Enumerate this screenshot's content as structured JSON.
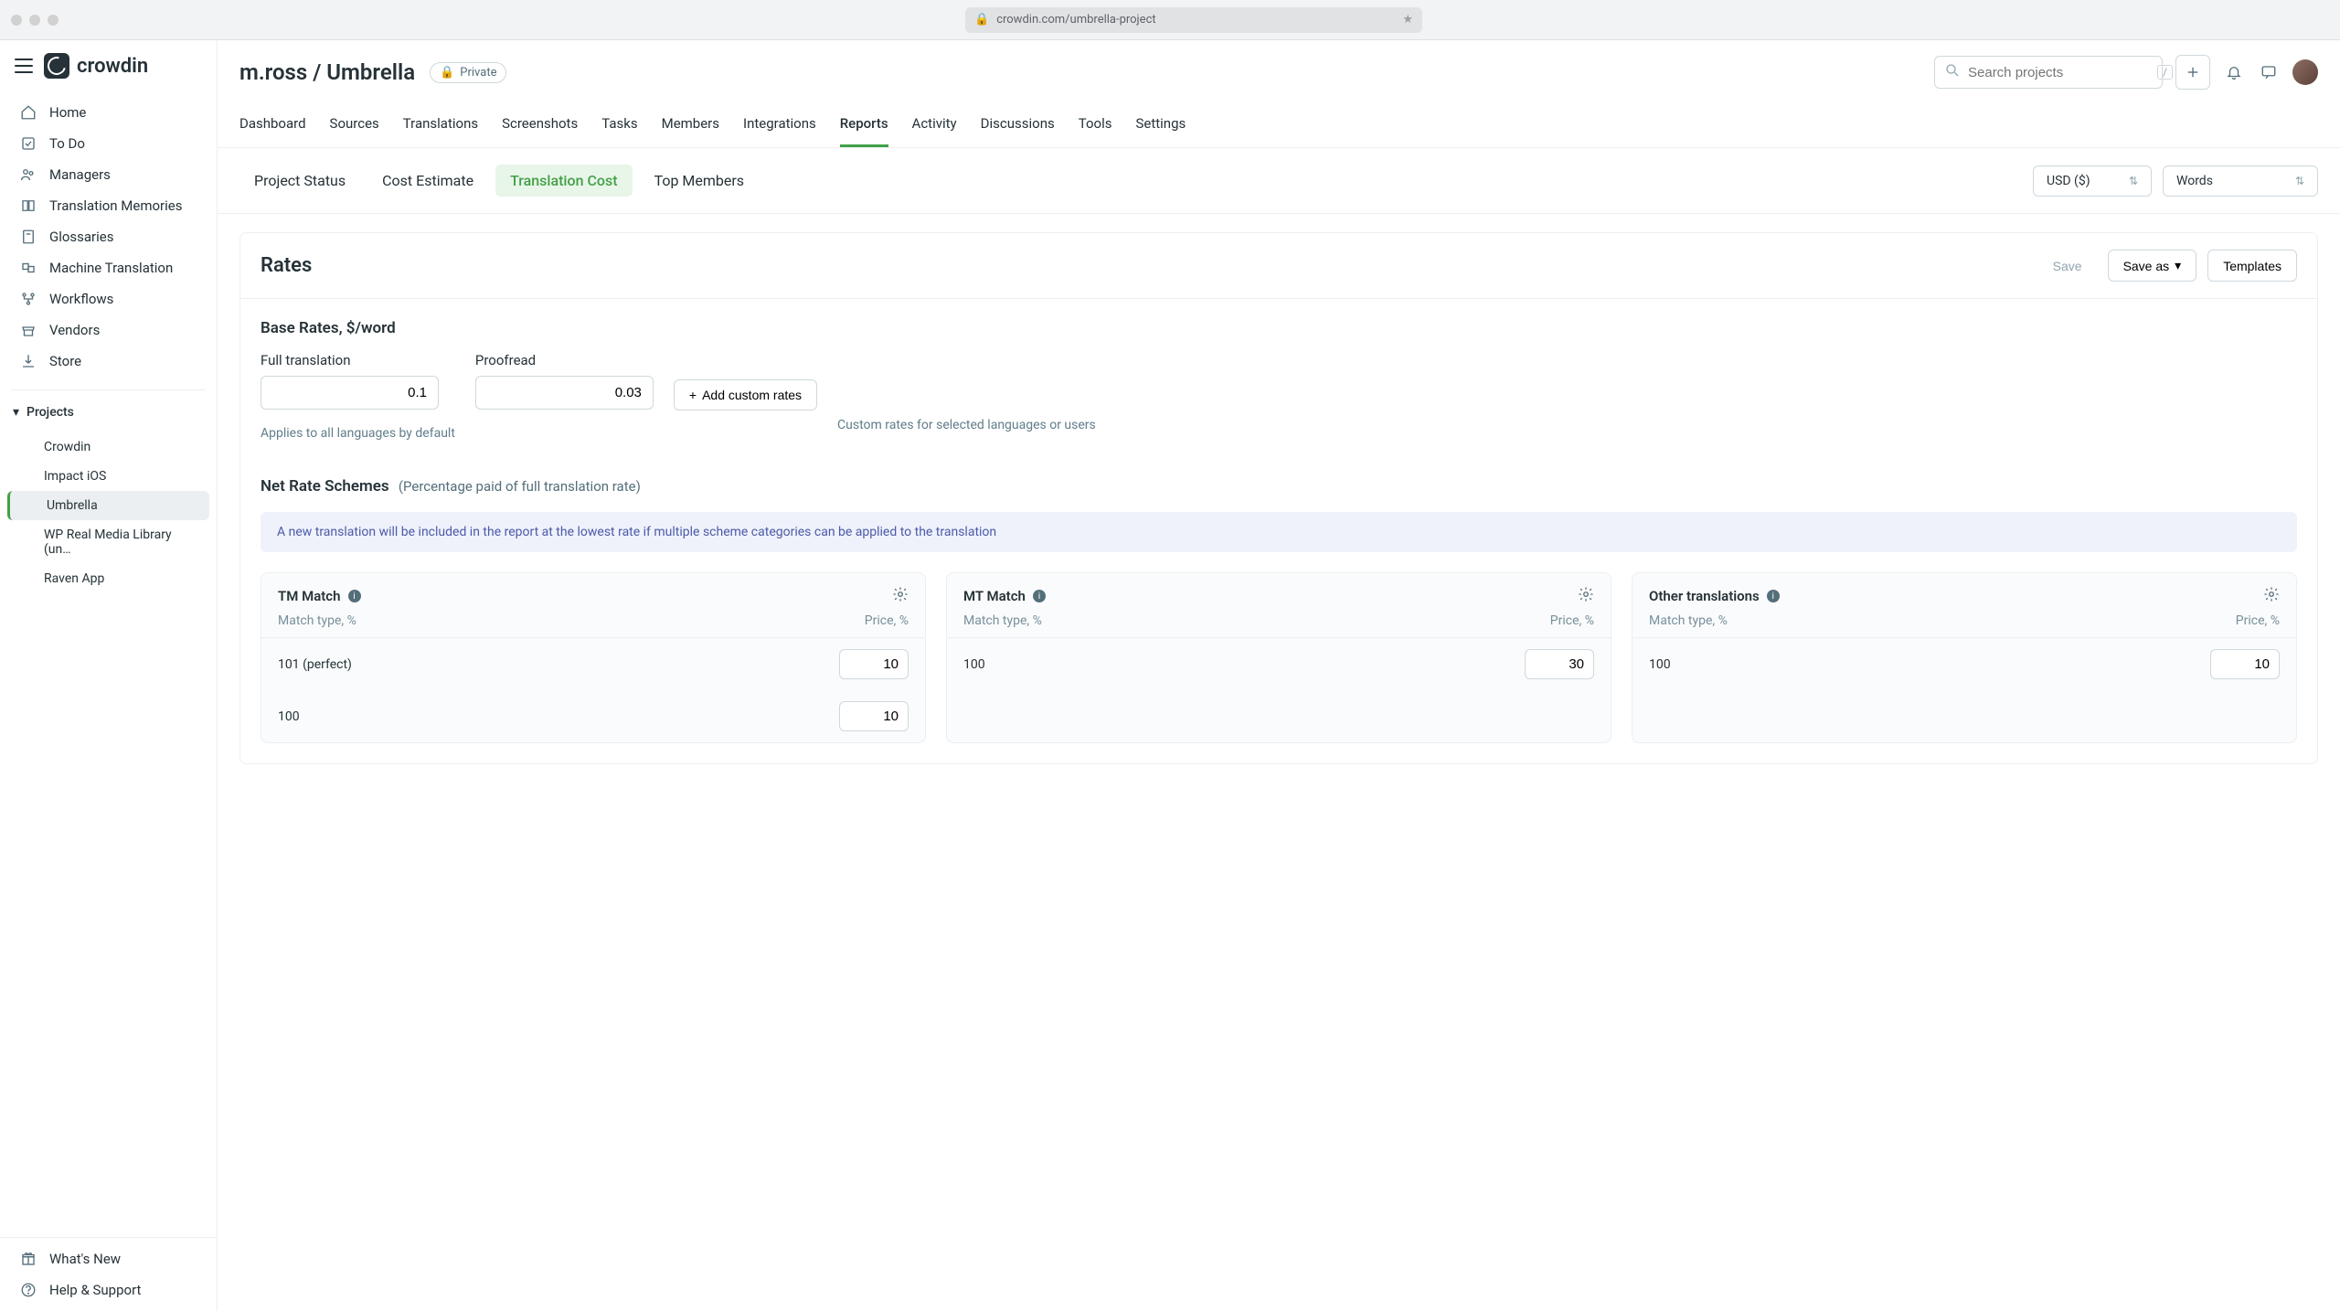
{
  "browser": {
    "url": "crowdin.com/umbrella-project"
  },
  "brand": "crowdin",
  "sidebar": {
    "items": [
      {
        "label": "Home",
        "icon": "home-icon"
      },
      {
        "label": "To Do",
        "icon": "todo-icon"
      },
      {
        "label": "Managers",
        "icon": "people-icon"
      },
      {
        "label": "Translation Memories",
        "icon": "book-icon"
      },
      {
        "label": "Glossaries",
        "icon": "glossary-icon"
      },
      {
        "label": "Machine Translation",
        "icon": "mt-icon"
      },
      {
        "label": "Workflows",
        "icon": "workflow-icon"
      },
      {
        "label": "Vendors",
        "icon": "store-icon"
      },
      {
        "label": "Store",
        "icon": "download-icon"
      }
    ],
    "projects_label": "Projects",
    "projects": [
      {
        "label": "Crowdin"
      },
      {
        "label": "Impact iOS"
      },
      {
        "label": "Umbrella",
        "active": true
      },
      {
        "label": "WP Real Media Library (un…"
      },
      {
        "label": "Raven App"
      }
    ],
    "footer": [
      {
        "label": "What's New",
        "icon": "gift-icon"
      },
      {
        "label": "Help & Support",
        "icon": "help-icon"
      }
    ]
  },
  "header": {
    "breadcrumb": "m.ross / Umbrella",
    "private": "Private",
    "search_placeholder": "Search projects",
    "search_hotkey": "/"
  },
  "tabs": [
    "Dashboard",
    "Sources",
    "Translations",
    "Screenshots",
    "Tasks",
    "Members",
    "Integrations",
    "Reports",
    "Activity",
    "Discussions",
    "Tools",
    "Settings"
  ],
  "active_tab": "Reports",
  "subtabs": [
    "Project Status",
    "Cost Estimate",
    "Translation Cost",
    "Top Members"
  ],
  "active_subtab": "Translation Cost",
  "currency": "USD ($)",
  "unit": "Words",
  "rates": {
    "title": "Rates",
    "save": "Save",
    "save_as": "Save as",
    "templates": "Templates",
    "base_heading": "Base Rates, $/word",
    "full_label": "Full translation",
    "full_value": "0.1",
    "proof_label": "Proofread",
    "proof_value": "0.03",
    "add_custom": "Add custom rates",
    "hint_default": "Applies to all languages by default",
    "hint_custom": "Custom rates for selected languages or users"
  },
  "schemes": {
    "heading": "Net Rate Schemes",
    "sub": "(Percentage paid of full translation rate)",
    "banner": "A new translation will be included in the report at the lowest rate if multiple scheme categories can be applied to the translation",
    "col_match": "Match type, %",
    "col_price": "Price, %",
    "cards": [
      {
        "title": "TM Match",
        "rows": [
          {
            "label": "101 (perfect)",
            "value": "10"
          },
          {
            "label": "100",
            "value": "10"
          }
        ]
      },
      {
        "title": "MT Match",
        "rows": [
          {
            "label": "100",
            "value": "30"
          }
        ]
      },
      {
        "title": "Other translations",
        "rows": [
          {
            "label": "100",
            "value": "10"
          }
        ]
      }
    ]
  }
}
